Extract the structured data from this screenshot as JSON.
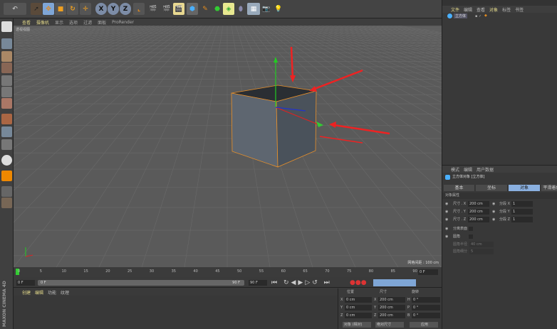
{
  "viewport": {
    "menu": [
      "查看",
      "摄像机",
      "显示",
      "选项",
      "过滤",
      "面板",
      "ProRender"
    ],
    "label": "透视视图",
    "grid_info": "网格间距 : 100 cm"
  },
  "toolbar": {
    "axis": [
      "X",
      "Y",
      "Z"
    ]
  },
  "object_manager": {
    "menu": [
      "文件",
      "编辑",
      "查看",
      "对象",
      "标签",
      "书签"
    ],
    "objects": [
      {
        "name": "立方体"
      }
    ]
  },
  "attributes": {
    "menu": [
      "模式",
      "编辑",
      "用户数据"
    ],
    "title": "立方体对象 [立方体]",
    "tabs": [
      "基本",
      "坐标",
      "对象",
      "平滑着色(Phong)"
    ],
    "active_tab": "对象",
    "section": "对象属性",
    "size": [
      {
        "label": "尺寸 . X",
        "value": "200 cm"
      },
      {
        "label": "尺寸 . Y",
        "value": "200 cm"
      },
      {
        "label": "尺寸 . Z",
        "value": "200 cm"
      }
    ],
    "segments": [
      {
        "label": "分段 X",
        "value": "1"
      },
      {
        "label": "分段 Y",
        "value": "1"
      },
      {
        "label": "分段 Z",
        "value": "1"
      }
    ],
    "separate_surfaces": "分离表面",
    "fillet": "圆角",
    "fillet_radius": {
      "label": "圆角半径",
      "value": "40 cm"
    },
    "fillet_subdivision": {
      "label": "圆角细分",
      "value": "5"
    }
  },
  "timeline": {
    "ticks": [
      "0",
      "5",
      "10",
      "15",
      "20",
      "25",
      "30",
      "35",
      "40",
      "45",
      "50",
      "55",
      "60",
      "65",
      "70",
      "75",
      "80",
      "85",
      "90"
    ],
    "current_frame": "0 F",
    "start": "0 F",
    "range_start": "0 F",
    "range_end": "90 F",
    "end": "90 F"
  },
  "materials": {
    "menu": [
      "创建",
      "编辑",
      "功能",
      "纹理"
    ]
  },
  "coordinates": {
    "headers": [
      "位置",
      "尺寸",
      "旋转"
    ],
    "rows": [
      {
        "axis": "X",
        "pos": "0 cm",
        "size_axis": "X",
        "size": "200 cm",
        "rot_axis": "H",
        "rot": "0 °"
      },
      {
        "axis": "Y",
        "pos": "0 cm",
        "size_axis": "Y",
        "size": "200 cm",
        "rot_axis": "P",
        "rot": "0 °"
      },
      {
        "axis": "Z",
        "pos": "0 cm",
        "size_axis": "Z",
        "size": "200 cm",
        "rot_axis": "B",
        "rot": "0 °"
      }
    ],
    "mode": "对象 (相对)",
    "size_mode": "绝对尺寸",
    "apply": "应用"
  },
  "brand": "MAXON CINEMA 4D"
}
